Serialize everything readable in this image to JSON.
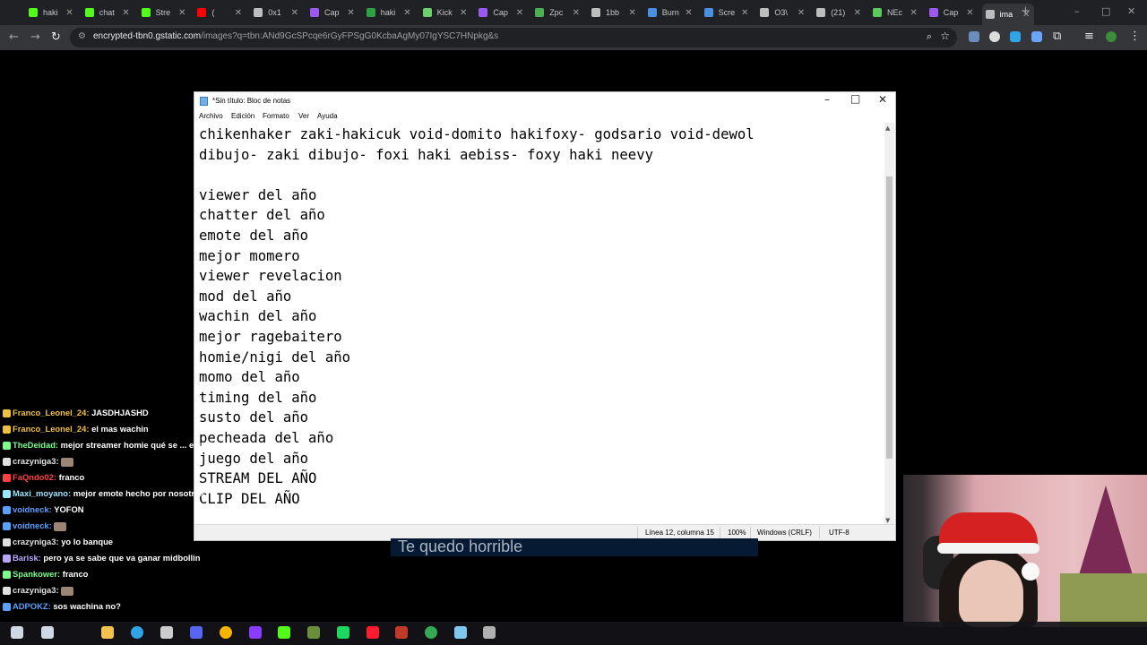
{
  "browser": {
    "tabs": [
      {
        "label": "haki",
        "color": "#53fc18"
      },
      {
        "label": "chat",
        "color": "#53fc18"
      },
      {
        "label": "Stre",
        "color": "#53fc18"
      },
      {
        "label": "(",
        "color": "#ff0000"
      },
      {
        "label": "0x1",
        "color": "#bdbdbd"
      },
      {
        "label": "Cap",
        "color": "#9b59f0"
      },
      {
        "label": "haki",
        "color": "#2ea043"
      },
      {
        "label": "Kick",
        "color": "#6fcf6f"
      },
      {
        "label": "Cap",
        "color": "#9b59f0"
      },
      {
        "label": "Zpc",
        "color": "#4caf50"
      },
      {
        "label": "1bb",
        "color": "#bdbdbd"
      },
      {
        "label": "Burn",
        "color": "#4a8fe0"
      },
      {
        "label": "Scre",
        "color": "#4a8fe0"
      },
      {
        "label": "O3\\",
        "color": "#bdbdbd"
      },
      {
        "label": "(21)",
        "color": "#bdbdbd"
      },
      {
        "label": "NEc",
        "color": "#5ac85a"
      },
      {
        "label": "Cap",
        "color": "#9b59f0"
      },
      {
        "label": "ima",
        "color": "#bdbdbd"
      }
    ],
    "url_host": "encrypted-tbn0.gstatic.com",
    "url_path": "/images?q=tbn:ANd9GcSPcqe6rGyFPSgG0KcbaAgMy07IgYSC7HNpkg&s"
  },
  "notepad": {
    "title": "*Sin título: Bloc de notas",
    "menu": [
      "Archivo",
      "Edición",
      "Formato",
      "Ver",
      "Ayuda"
    ],
    "lines": [
      "chikenhaker zaki-hakicuk void-domito hakifoxy- godsario void-dewol",
      "dibujo- zaki dibujo- foxi haki aebiss- foxy haki neevy",
      "",
      "viewer del año",
      "chatter del año",
      "emote del año",
      "mejor momero",
      "viewer revelacion",
      "mod del año",
      "wachin del año",
      "mejor ragebaitero",
      "homie/nigi del año",
      "momo del año",
      "timing del año",
      "susto del año",
      "pecheada del año",
      "juego del año",
      "STREAM DEL AÑO",
      "CLIP DEL AÑO"
    ],
    "status": {
      "position": "Línea 12, columna 15",
      "zoom": "100%",
      "eol": "Windows (CRLF)",
      "encoding": "UTF-8"
    }
  },
  "subtitle": "Te quedo horrible",
  "chat": [
    {
      "user": "Franco_Leonel_24",
      "color": "#f0c040",
      "text": "JASDHJASHD"
    },
    {
      "user": "Franco_Leonel_24",
      "color": "#f0c040",
      "text": "el mas wachin"
    },
    {
      "user": "TheDeidad",
      "color": "#7cfc8c",
      "text": "mejor streamer homie qué se ... españa"
    },
    {
      "user": "crazyniga3",
      "color": "#e0e0e0",
      "text": ""
    },
    {
      "user": "FaQndo02",
      "color": "#ff4040",
      "text": "franco"
    },
    {
      "user": "Maxi_moyano",
      "color": "#9ae6ff",
      "text": "mejor emote hecho por nosotros"
    },
    {
      "user": "voidneck",
      "color": "#5aa0ff",
      "text": "YOFON"
    },
    {
      "user": "voidneck",
      "color": "#5aa0ff",
      "text": ""
    },
    {
      "user": "crazyniga3",
      "color": "#e0e0e0",
      "text": "yo lo banque"
    },
    {
      "user": "Barisk",
      "color": "#b8a6ff",
      "text": "pero ya se sabe que va ganar midbollin"
    },
    {
      "user": "Spankower",
      "color": "#7cfc8c",
      "text": "franco"
    },
    {
      "user": "crazyniga3",
      "color": "#e0e0e0",
      "text": ""
    },
    {
      "user": "ADPOKZ",
      "color": "#5aa0ff",
      "text": "sos wachina no?"
    }
  ],
  "taskbar_icons": [
    {
      "name": "windows-icon",
      "color": "#cfd8e3"
    },
    {
      "name": "search-icon",
      "color": "#cfd8e3"
    },
    {
      "name": "file-explorer-icon",
      "color": "#f2c14e"
    },
    {
      "name": "edge-icon",
      "color": "#2fa4e7"
    },
    {
      "name": "github-icon",
      "color": "#cccccc"
    },
    {
      "name": "discord-icon",
      "color": "#5865f2"
    },
    {
      "name": "chrome-icon",
      "color": "#f4b400"
    },
    {
      "name": "canva-icon",
      "color": "#8b3dff"
    },
    {
      "name": "kick-icon",
      "color": "#53fc18"
    },
    {
      "name": "minecraft-icon",
      "color": "#6b8e3a"
    },
    {
      "name": "spotify-icon",
      "color": "#1ed760"
    },
    {
      "name": "opera-icon",
      "color": "#ff1b2d"
    },
    {
      "name": "voicemeeter-icon",
      "color": "#c0392b"
    },
    {
      "name": "chrome-alt-icon",
      "color": "#34a853"
    },
    {
      "name": "notepad-icon",
      "color": "#7ec8f0"
    },
    {
      "name": "settings-icon",
      "color": "#b0b0b0"
    }
  ]
}
